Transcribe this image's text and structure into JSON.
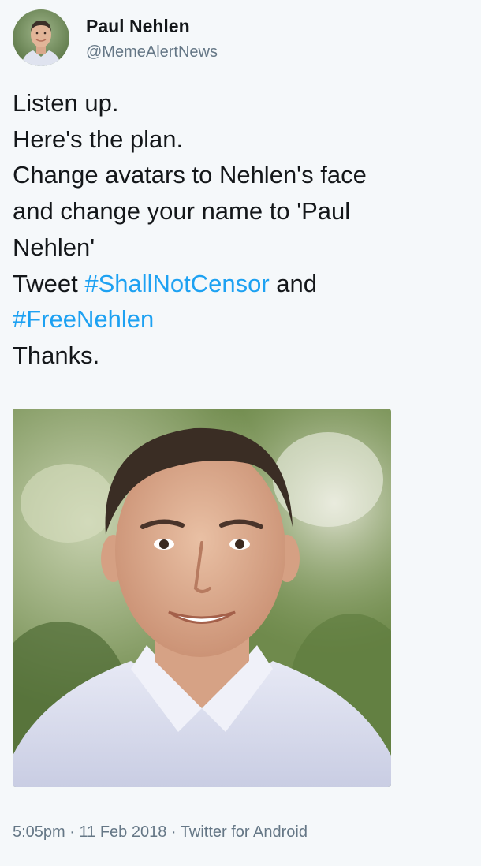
{
  "author": {
    "display_name": "Paul Nehlen",
    "handle": "@MemeAlertNews",
    "avatar_icon": "person-avatar"
  },
  "tweet": {
    "lines": [
      {
        "text": "Listen up."
      },
      {
        "text": "Here's the plan."
      },
      {
        "text": "Change avatars to Nehlen's face"
      },
      {
        "text": "and change your name to 'Paul"
      },
      {
        "text": "Nehlen'"
      },
      {
        "prefix": "Tweet ",
        "hashtag": "#ShallNotCensor",
        "suffix": " and"
      },
      {
        "hashtag": "#FreeNehlen"
      },
      {
        "text": "Thanks."
      }
    ]
  },
  "photo": {
    "subject": "man-portrait-photo"
  },
  "meta": {
    "time": "5:05pm",
    "separator": " · ",
    "date": "11 Feb 2018",
    "source": "Twitter for Android"
  },
  "colors": {
    "background": "#f5f8fa",
    "text": "#14171a",
    "muted": "#657786",
    "link": "#1da1f2"
  }
}
